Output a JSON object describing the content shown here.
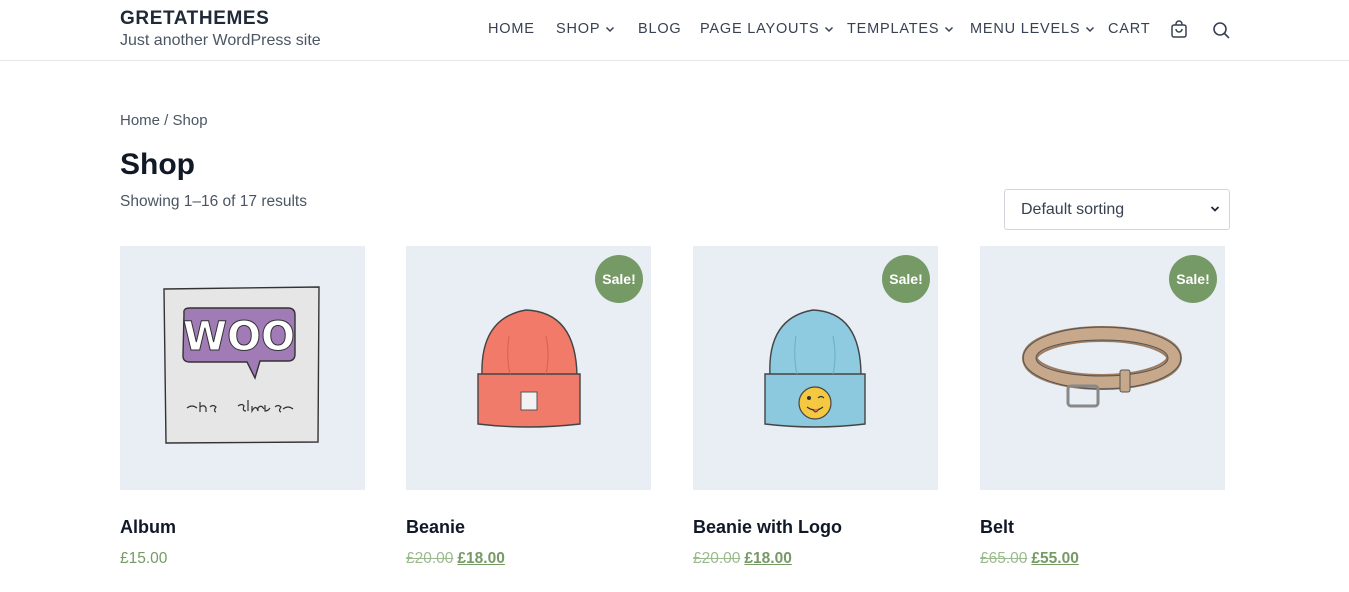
{
  "site": {
    "title": "GRETATHEMES",
    "tagline": "Just another WordPress site"
  },
  "nav": {
    "home": "HOME",
    "shop": "SHOP",
    "blog": "BLOG",
    "page_layouts": "PAGE LAYOUTS",
    "templates": "TEMPLATES",
    "menu_levels": "MENU LEVELS",
    "cart": "CART",
    "icons": [
      "cart-icon",
      "search-icon"
    ]
  },
  "breadcrumb": {
    "home": "Home",
    "separator": " / ",
    "current": "Shop"
  },
  "page": {
    "title": "Shop",
    "result_count": "Showing 1–16 of 17 results",
    "sorting": "Default sorting"
  },
  "colors": {
    "accent": "#769a65",
    "image_bg": "#e8eef3"
  },
  "products": [
    {
      "name": "Album",
      "price": "£15.00",
      "sale": false
    },
    {
      "name": "Beanie",
      "sale_label": "Sale!",
      "old_price": "£20.00",
      "new_price": "£18.00",
      "sale": true
    },
    {
      "name": "Beanie with Logo",
      "sale_label": "Sale!",
      "old_price": "£20.00",
      "new_price": "£18.00",
      "sale": true
    },
    {
      "name": "Belt",
      "sale_label": "Sale!",
      "old_price": "£65.00",
      "new_price": "£55.00",
      "sale": true
    }
  ]
}
